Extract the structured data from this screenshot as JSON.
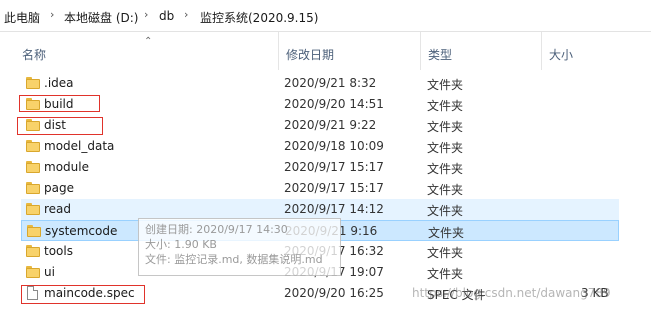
{
  "breadcrumb": {
    "items": [
      "此电脑",
      "本地磁盘 (D:)",
      "db",
      "监控系统(2020.9.15)"
    ],
    "separator": "›"
  },
  "columns": {
    "name": "名称",
    "date": "修改日期",
    "type": "类型",
    "size": "大小"
  },
  "rows": [
    {
      "icon": "folder-icon",
      "name": ".idea",
      "date": "2020/9/21 8:32",
      "type": "文件夹",
      "size": ""
    },
    {
      "icon": "folder-icon",
      "name": "build",
      "date": "2020/9/20 14:51",
      "type": "文件夹",
      "size": ""
    },
    {
      "icon": "folder-icon",
      "name": "dist",
      "date": "2020/9/21 9:22",
      "type": "文件夹",
      "size": ""
    },
    {
      "icon": "folder-icon",
      "name": "model_data",
      "date": "2020/9/18 10:09",
      "type": "文件夹",
      "size": ""
    },
    {
      "icon": "folder-icon",
      "name": "module",
      "date": "2020/9/17 15:17",
      "type": "文件夹",
      "size": ""
    },
    {
      "icon": "folder-icon",
      "name": "page",
      "date": "2020/9/17 15:17",
      "type": "文件夹",
      "size": ""
    },
    {
      "icon": "folder-icon",
      "name": "read",
      "date": "2020/9/17 14:12",
      "type": "文件夹",
      "size": ""
    },
    {
      "icon": "folder-icon",
      "name": "systemcode",
      "date": "2020/9/21 9:16",
      "type": "文件夹",
      "size": ""
    },
    {
      "icon": "folder-icon",
      "name": "tools",
      "date": "2020/9/17 16:32",
      "type": "文件夹",
      "size": ""
    },
    {
      "icon": "folder-icon",
      "name": "ui",
      "date": "2020/9/17 19:07",
      "type": "文件夹",
      "size": ""
    },
    {
      "icon": "file-icon",
      "name": "maincode.spec",
      "date": "2020/9/20 16:25",
      "type": "SPEC 文件",
      "size": "3 KB"
    }
  ],
  "tooltip": {
    "created": "创建日期: 2020/9/17 14:30",
    "size": "大小: 1.90 KB",
    "files": "文件: 监控记录.md, 数据集说明.md"
  },
  "watermark": "https://blog.csdn.net/dawang789",
  "colors": {
    "hover": "#e5f3ff",
    "selected": "#cce8ff",
    "annotation": "#e0332b",
    "folder": "#f8d26a"
  }
}
